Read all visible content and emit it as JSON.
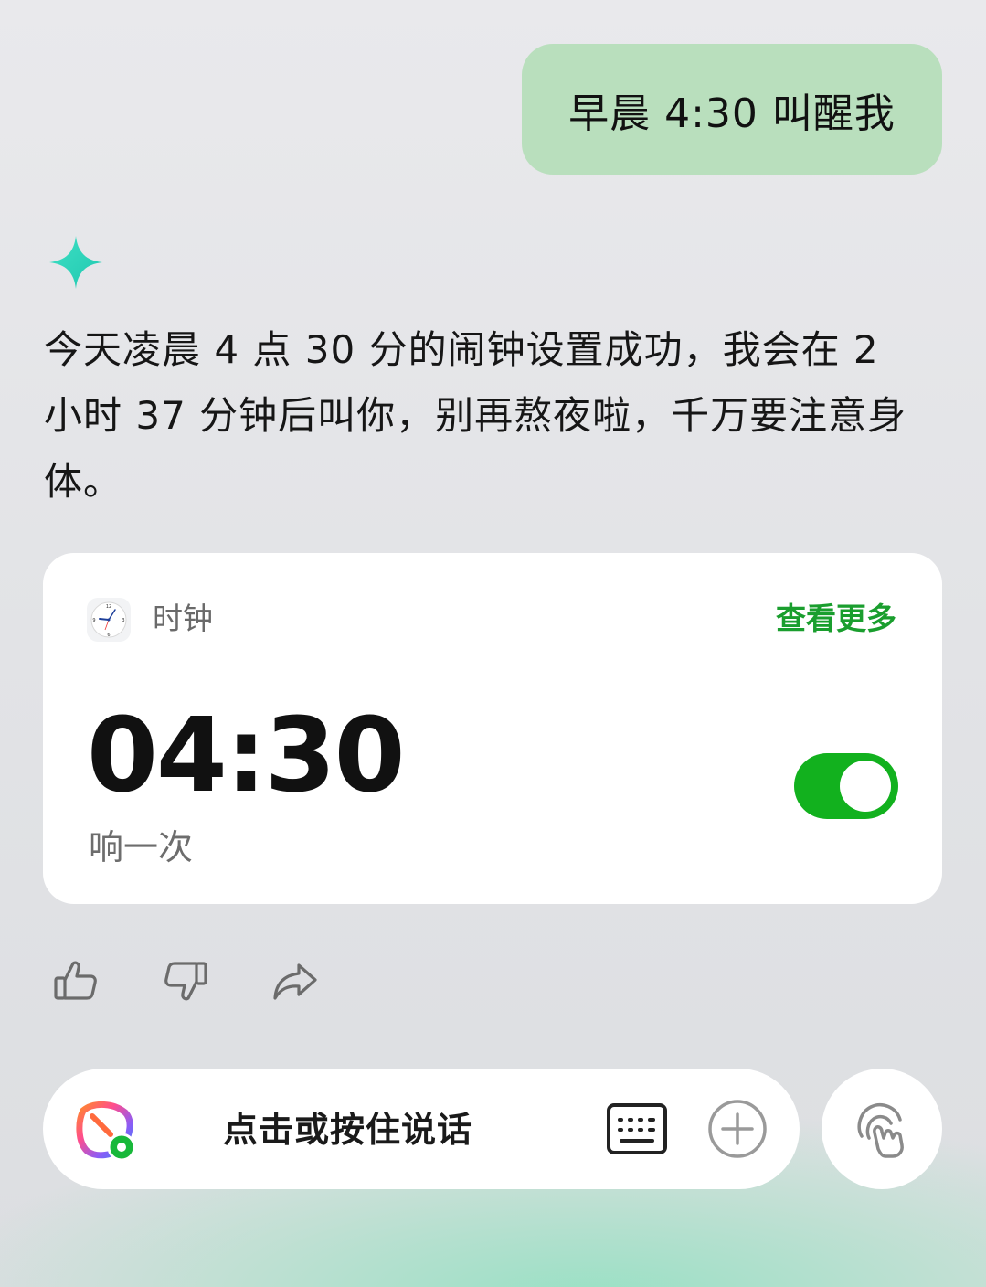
{
  "user_message": "早晨 4:30 叫醒我",
  "assistant": {
    "reply": "今天凌晨 4 点 30 分的闹钟设置成功，我会在 2 小时 37 分钟后叫你，别再熬夜啦，千万要注意身体。"
  },
  "alarm_card": {
    "app_name": "时钟",
    "see_more_label": "查看更多",
    "time": "04:30",
    "repeat": "响一次",
    "enabled": true,
    "toggle_color": "#12b11e",
    "link_color": "#1a9e2e"
  },
  "feedback": {
    "icons": [
      "thumbs-up-icon",
      "thumbs-down-icon",
      "share-icon"
    ]
  },
  "input_bar": {
    "voice_label": "点击或按住说话",
    "icons": [
      "assistant-logo-icon",
      "keyboard-icon",
      "plus-icon",
      "touch-gesture-icon"
    ]
  },
  "colors": {
    "user_bubble": "#b9dfbd",
    "sparkle": "#2fd3b8"
  }
}
